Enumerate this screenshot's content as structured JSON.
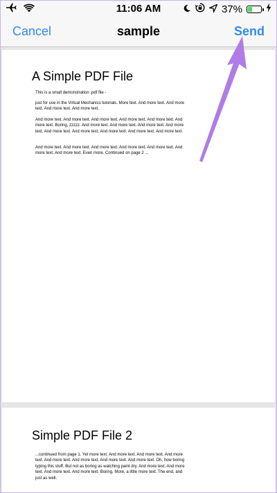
{
  "status_bar": {
    "time": "11:06 AM",
    "battery_percent": "37%",
    "battery_level": 0.37,
    "icons": [
      "airplane-icon",
      "wifi-icon",
      "moon-icon",
      "rotation-lock-icon",
      "location-arrow-icon",
      "battery-icon",
      "charging-bolt-icon"
    ],
    "battery_color": "#4cd964"
  },
  "nav": {
    "cancel_label": "Cancel",
    "title": "sample",
    "send_label": "Send",
    "accent_color": "#2f8ce9"
  },
  "document": {
    "pages": [
      {
        "heading": "A Simple PDF File",
        "paragraphs": [
          "This is a small demonstration .pdf file -",
          "just for use in the Virtual Mechanics tutorials. More text. And more text. And more text. And more text. And more text.",
          "And more text. And more text. And more text. And more text. And more text. And more text. Boring, zzzzz. And more text. And more text. And more text. And more text. And more text. And more text. And more text. And more text. And more text.",
          "And more text. And more text. And more text. And more text. And more text. And more text. And more text. Even more. Continued on page 2 ..."
        ]
      },
      {
        "heading": "Simple PDF File 2",
        "paragraphs": [
          "...continued from page 1. Yet more text. And more text. And more text. And more text. And more text. And more text. And more text. And more text. Oh, how boring typing this stuff. But not as boring as watching paint dry. And more text. And more text. And more text. And more text. Boring.  More, a little more text. The end, and just as well."
        ]
      }
    ]
  },
  "annotation": {
    "arrow_color": "#b07ce6"
  }
}
